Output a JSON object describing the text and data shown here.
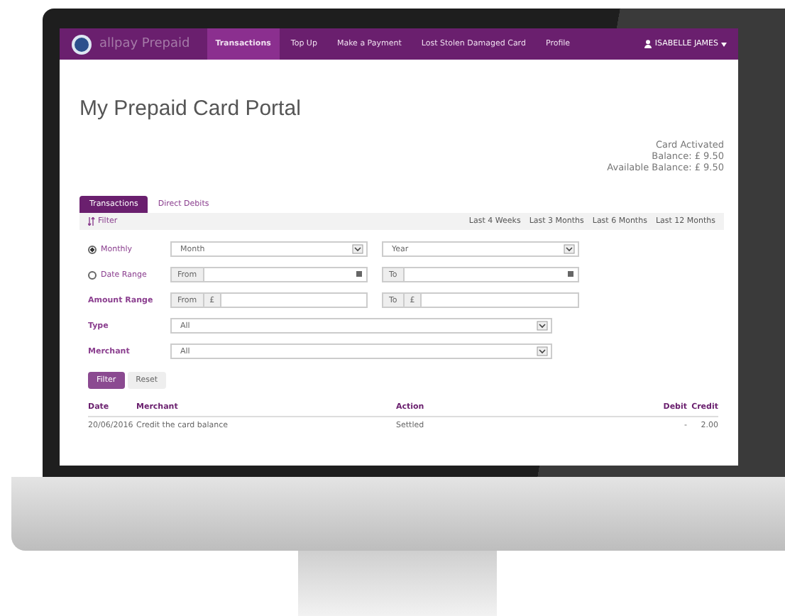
{
  "navbar": {
    "brand": "allpay Prepaid",
    "items": [
      {
        "label": "Transactions",
        "selected": true
      },
      {
        "label": "Top Up",
        "selected": false
      },
      {
        "label": "Make a Payment",
        "selected": false
      },
      {
        "label": "Lost Stolen Damaged Card",
        "selected": false
      },
      {
        "label": "Profile",
        "selected": false
      }
    ],
    "user": "ISABELLE JAMES"
  },
  "title": "My Prepaid Card Portal",
  "card_status": [
    "Card Activated",
    "Balance: £ 9.50",
    "Available Balance: £ 9.50"
  ],
  "tabs": [
    {
      "label": "Transactions",
      "selected": true
    },
    {
      "label": "Direct Debits",
      "selected": false
    }
  ],
  "filter_bar": {
    "label": "Filter",
    "periods": [
      "Last 4 Weeks",
      "Last 3 Months",
      "Last 6 Months",
      "Last 12 Months"
    ]
  },
  "period_options": [
    {
      "label": "Monthly",
      "selected": true,
      "fields": [
        {
          "kind": "select",
          "value": "Month"
        },
        {
          "kind": "select",
          "value": "Year"
        }
      ]
    },
    {
      "label": "Date Range",
      "selected": false,
      "fields": [
        {
          "kind": "date",
          "prefix": "From"
        },
        {
          "kind": "date",
          "prefix": "To"
        }
      ]
    }
  ],
  "amount_range": {
    "label": "Amount Range",
    "fields": [
      {
        "prefix": "From",
        "currency": "£"
      },
      {
        "prefix": "To",
        "currency": "£"
      }
    ]
  },
  "selects": [
    {
      "label": "Type",
      "value": "All"
    },
    {
      "label": "Merchant",
      "value": "All"
    }
  ],
  "buttons": [
    {
      "label": "Filter",
      "kind": "primary"
    },
    {
      "label": "Reset",
      "kind": "secondary"
    }
  ],
  "table": {
    "columns": [
      "Date",
      "Merchant",
      "Action",
      "Debit",
      "Credit"
    ],
    "rows": [
      [
        "20/06/2016",
        "Credit the card balance",
        "Settled",
        "-",
        "2.00"
      ]
    ]
  }
}
